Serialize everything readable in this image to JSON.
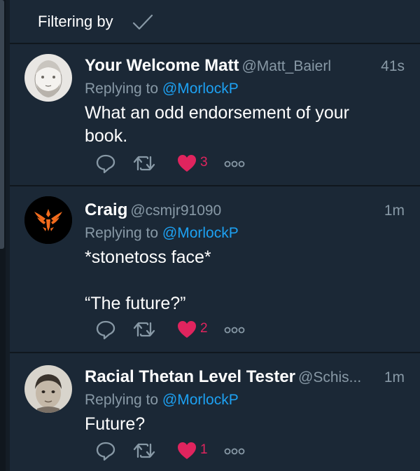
{
  "filter": {
    "label": "Filtering by"
  },
  "tweets": [
    {
      "display_name": "Your Welcome Matt",
      "handle": "@Matt_Baierl",
      "time": "41s",
      "replying_prefix": "Replying to ",
      "replying_to": "@MorlockP",
      "text": "What an odd endorsement of your\nbook.",
      "likes": "3"
    },
    {
      "display_name": "Craig",
      "handle": "@csmjr91090",
      "time": "1m",
      "replying_prefix": "Replying to ",
      "replying_to": "@MorlockP",
      "text": "*stonetoss face*\n\n“The future?”",
      "likes": "2"
    },
    {
      "display_name": "Racial Thetan Level Tester",
      "handle": "@Schis...",
      "time": "1m",
      "replying_prefix": "Replying to ",
      "replying_to": "@MorlockP",
      "text": "Future?",
      "likes": "1"
    }
  ],
  "icons": {
    "reply": "reply-icon",
    "retweet": "retweet-icon",
    "like": "heart-icon",
    "more": "more-icon"
  },
  "colors": {
    "background": "#141d26",
    "card": "#1b2836",
    "secondary_text": "#8899a6",
    "link": "#1da1f2",
    "like": "#e0245e"
  }
}
